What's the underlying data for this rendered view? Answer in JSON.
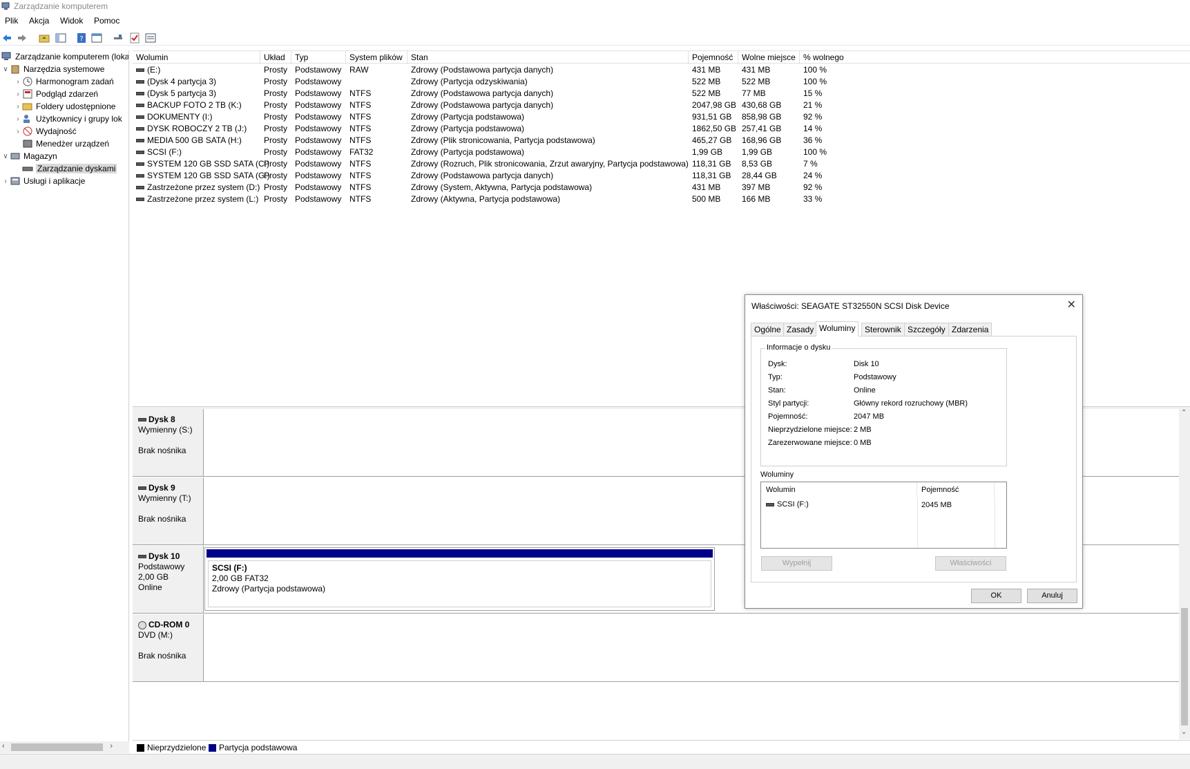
{
  "window": {
    "title": "Zarządzanie komputerem"
  },
  "menu": [
    "Plik",
    "Akcja",
    "Widok",
    "Pomoc"
  ],
  "toolbar": {
    "icons": [
      "back-arrow-icon",
      "forward-arrow-icon",
      "up-folder-icon",
      "show-hide-tree-icon",
      "help-icon",
      "properties-icon",
      "connect-icon",
      "check-icon",
      "list-icon"
    ]
  },
  "tree": {
    "root": "Zarządzanie komputerem (loka",
    "system_tools": "Narzędzia systemowe",
    "task_scheduler": "Harmonogram zadań",
    "event_viewer": "Podgląd zdarzeń",
    "shared_folders": "Foldery udostępnione",
    "local_users": "Użytkownicy i grupy lok",
    "performance": "Wydajność",
    "device_manager": "Menedżer urządzeń",
    "storage": "Magazyn",
    "disk_management": "Zarządzanie dyskami",
    "services": "Usługi i aplikacje"
  },
  "volume_list": {
    "columns": [
      "Wolumin",
      "Układ",
      "Typ",
      "System plików",
      "Stan",
      "Pojemność",
      "Wolne miejsce",
      "% wolnego"
    ],
    "rows": [
      [
        "(E:)",
        "Prosty",
        "Podstawowy",
        "RAW",
        "Zdrowy (Podstawowa partycja danych)",
        "431 MB",
        "431 MB",
        "100 %"
      ],
      [
        "(Dysk 4 partycja 3)",
        "Prosty",
        "Podstawowy",
        "",
        "Zdrowy (Partycja odzyskiwania)",
        "522 MB",
        "522 MB",
        "100 %"
      ],
      [
        "(Dysk 5 partycja 3)",
        "Prosty",
        "Podstawowy",
        "NTFS",
        "Zdrowy (Podstawowa partycja danych)",
        "522 MB",
        "77 MB",
        "15 %"
      ],
      [
        "BACKUP FOTO 2 TB (K:)",
        "Prosty",
        "Podstawowy",
        "NTFS",
        "Zdrowy (Podstawowa partycja danych)",
        "2047,98 GB",
        "430,68 GB",
        "21 %"
      ],
      [
        "DOKUMENTY (I:)",
        "Prosty",
        "Podstawowy",
        "NTFS",
        "Zdrowy (Partycja podstawowa)",
        "931,51 GB",
        "858,98 GB",
        "92 %"
      ],
      [
        "DYSK ROBOCZY 2 TB (J:)",
        "Prosty",
        "Podstawowy",
        "NTFS",
        "Zdrowy (Partycja podstawowa)",
        "1862,50 GB",
        "257,41 GB",
        "14 %"
      ],
      [
        "MEDIA 500 GB SATA (H:)",
        "Prosty",
        "Podstawowy",
        "NTFS",
        "Zdrowy (Plik stronicowania, Partycja podstawowa)",
        "465,27 GB",
        "168,96 GB",
        "36 %"
      ],
      [
        "SCSI (F:)",
        "Prosty",
        "Podstawowy",
        "FAT32",
        "Zdrowy (Partycja podstawowa)",
        "1,99 GB",
        "1,99 GB",
        "100 %"
      ],
      [
        "SYSTEM 120 GB  SSD SATA (C:)",
        "Prosty",
        "Podstawowy",
        "NTFS",
        "Zdrowy (Rozruch, Plik stronicowania, Zrzut awaryjny, Partycja podstawowa)",
        "118,31 GB",
        "8,53 GB",
        "7 %"
      ],
      [
        "SYSTEM 120 GB  SSD SATA (G:)",
        "Prosty",
        "Podstawowy",
        "NTFS",
        "Zdrowy (Podstawowa partycja danych)",
        "118,31 GB",
        "28,44 GB",
        "24 %"
      ],
      [
        "Zastrzeżone przez system (D:)",
        "Prosty",
        "Podstawowy",
        "NTFS",
        "Zdrowy (System, Aktywna, Partycja podstawowa)",
        "431 MB",
        "397 MB",
        "92 %"
      ],
      [
        "Zastrzeżone przez system (L:)",
        "Prosty",
        "Podstawowy",
        "NTFS",
        "Zdrowy (Aktywna, Partycja podstawowa)",
        "500 MB",
        "166 MB",
        "33 %"
      ]
    ]
  },
  "disks": [
    {
      "name": "Dysk 8",
      "line2": "Wymienny (S:)",
      "line3": "",
      "line4": "Brak nośnika"
    },
    {
      "name": "Dysk 9",
      "line2": "Wymienny (T:)",
      "line3": "",
      "line4": "Brak nośnika"
    },
    {
      "name": "Dysk 10",
      "line2": "Podstawowy",
      "line3": "2,00 GB",
      "line4": "Online",
      "partition": {
        "label": "SCSI  (F:)",
        "size": "2,00 GB FAT32",
        "status": "Zdrowy (Partycja podstawowa)"
      }
    },
    {
      "name": "CD-ROM 0",
      "line2": "DVD (M:)",
      "line3": "",
      "line4": "Brak nośnika"
    }
  ],
  "legend": {
    "unallocated": "Nieprzydzielone",
    "primary": "Partycja podstawowa",
    "unallocated_color": "#000000",
    "primary_color": "#00008b"
  },
  "dialog": {
    "title": "Właściwości: SEAGATE ST32550N SCSI Disk Device",
    "tabs": [
      "Ogólne",
      "Zasady",
      "Woluminy",
      "Sterownik",
      "Szczegóły",
      "Zdarzenia"
    ],
    "active_tab": "Woluminy",
    "disk_info_title": "Informacje o dysku",
    "info": [
      {
        "label": "Dysk:",
        "value": "Disk 10"
      },
      {
        "label": "Typ:",
        "value": "Podstawowy"
      },
      {
        "label": "Stan:",
        "value": "Online"
      },
      {
        "label": "Styl partycji:",
        "value": "Główny rekord rozruchowy (MBR)"
      },
      {
        "label": "Pojemność:",
        "value": "2047 MB"
      },
      {
        "label": "Nieprzydzielone miejsce:",
        "value": "2 MB"
      },
      {
        "label": "Zarezerwowane miejsce:",
        "value": "0 MB"
      }
    ],
    "volumes_title": "Woluminy",
    "vol_col_volume": "Wolumin",
    "vol_col_capacity": "Pojemność",
    "vol_name": "SCSI (F:)",
    "vol_capacity": "2045 MB",
    "populate_button": "Wypełnij",
    "properties_button": "Właściwości",
    "ok_button": "OK",
    "cancel_button": "Anuluj"
  }
}
